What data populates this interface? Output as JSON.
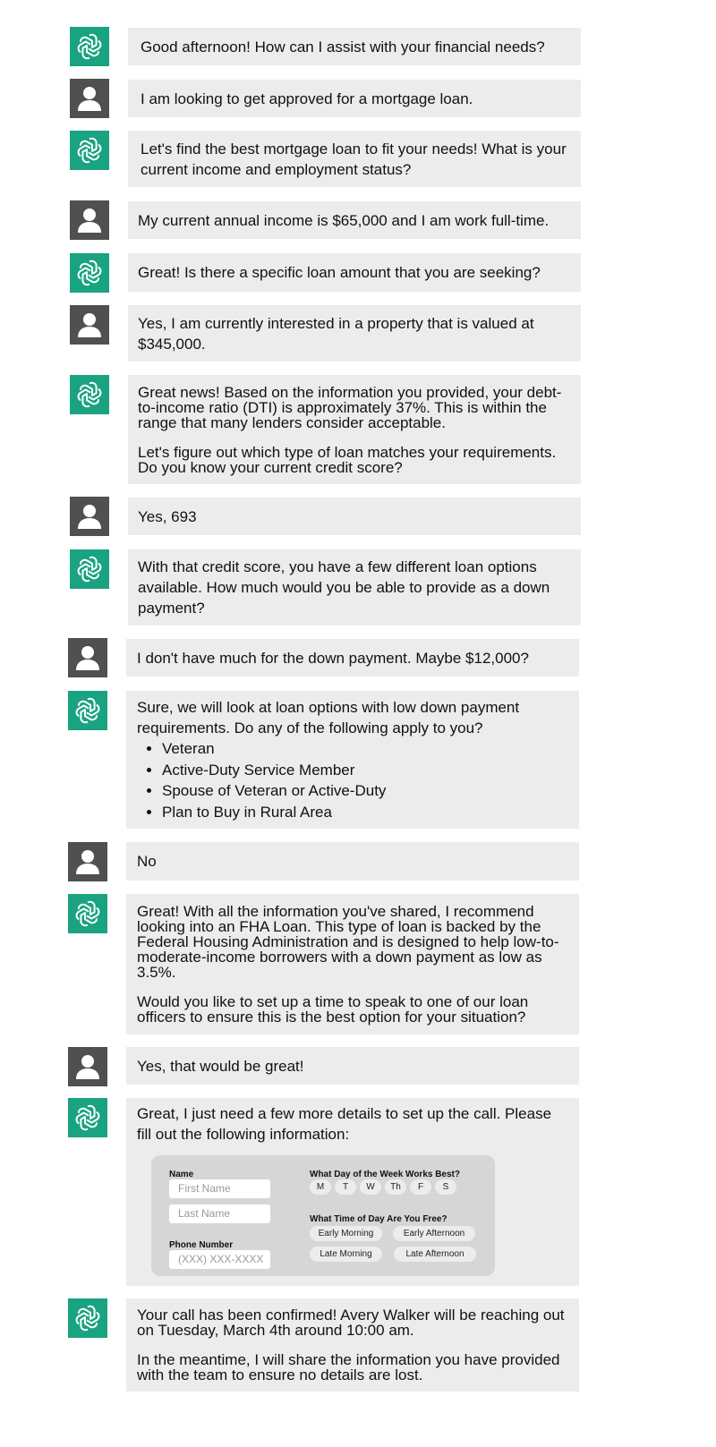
{
  "colors": {
    "bot_avatar": "#1aa380",
    "user_avatar": "#505050",
    "bubble_bg": "#ececec",
    "form_bg": "#d6d6d6"
  },
  "messages": [
    {
      "sender": "bot",
      "icon": "openai-logo-icon",
      "text": "Good afternoon! How can I assist with your financial needs?"
    },
    {
      "sender": "user",
      "icon": "user-avatar-icon",
      "text": "I am looking to get approved for a mortgage loan."
    },
    {
      "sender": "bot",
      "icon": "openai-logo-icon",
      "text": "Let's find the best mortgage loan to fit your needs! What is your current income and employment status?"
    },
    {
      "sender": "user",
      "icon": "user-avatar-icon",
      "text": "My current annual income is $65,000 and I am work full-time."
    },
    {
      "sender": "bot",
      "icon": "openai-logo-icon",
      "text": "Great! Is there a specific loan amount that you are seeking?"
    },
    {
      "sender": "user",
      "icon": "user-avatar-icon",
      "text": "Yes, I am currently interested in a property that is valued at $345,000."
    },
    {
      "sender": "bot",
      "icon": "openai-logo-icon",
      "p1": "Great news! Based on the information you provided, your debt-to-income ratio (DTI) is approximately 37%. This is within the range that many lenders consider acceptable.",
      "p2": "Let's figure out which type of loan matches your requirements. Do you know your current credit score?"
    },
    {
      "sender": "user",
      "icon": "user-avatar-icon",
      "text": "Yes, 693"
    },
    {
      "sender": "bot",
      "icon": "openai-logo-icon",
      "text": "With that credit score, you have a few different loan options available. How much would you be able to provide as a down payment?"
    },
    {
      "sender": "user",
      "icon": "user-avatar-icon",
      "text": "I don't have much for the down payment. Maybe $12,000?"
    },
    {
      "sender": "bot",
      "icon": "openai-logo-icon",
      "text": "Sure, we will look at loan options with low down payment requirements. Do any of the following apply to you?",
      "list": [
        "Veteran",
        "Active-Duty Service Member",
        "Spouse of Veteran or Active-Duty",
        "Plan to Buy in Rural Area"
      ]
    },
    {
      "sender": "user",
      "icon": "user-avatar-icon",
      "text": "No"
    },
    {
      "sender": "bot",
      "icon": "openai-logo-icon",
      "p1": "Great! With all the information you've shared, I recommend looking into an FHA Loan. This type of loan is backed by the Federal Housing Administration and is designed to help low-to-moderate-income borrowers with a down payment as low as 3.5%.",
      "p2": "Would you like to set up a time to speak to one of our loan officers to ensure this is the best option for your situation?"
    },
    {
      "sender": "user",
      "icon": "user-avatar-icon",
      "text": "Yes, that would be great!"
    },
    {
      "sender": "bot",
      "icon": "openai-logo-icon",
      "text": "Great, I just need a few more details to set up the call. Please fill out the following information:"
    },
    {
      "sender": "bot",
      "icon": "openai-logo-icon",
      "p1": "Your call has been confirmed! Avery Walker will be reaching out on Tuesday, March 4th around 10:00 am.",
      "p2": "In the meantime, I will share the information you have provided with the team to ensure no details are lost."
    }
  ],
  "form": {
    "name_label": "Name",
    "first_name_placeholder": "First Name",
    "last_name_placeholder": "Last Name",
    "phone_label": "Phone Number",
    "phone_placeholder": "(XXX) XXX-XXXX",
    "day_label": "What Day of the Week Works Best?",
    "days": [
      "M",
      "T",
      "W",
      "Th",
      "F",
      "S"
    ],
    "time_label": "What Time of Day Are You Free?",
    "times": [
      "Early Morning",
      "Early Afternoon",
      "Late Morning",
      "Late Afternoon"
    ]
  }
}
